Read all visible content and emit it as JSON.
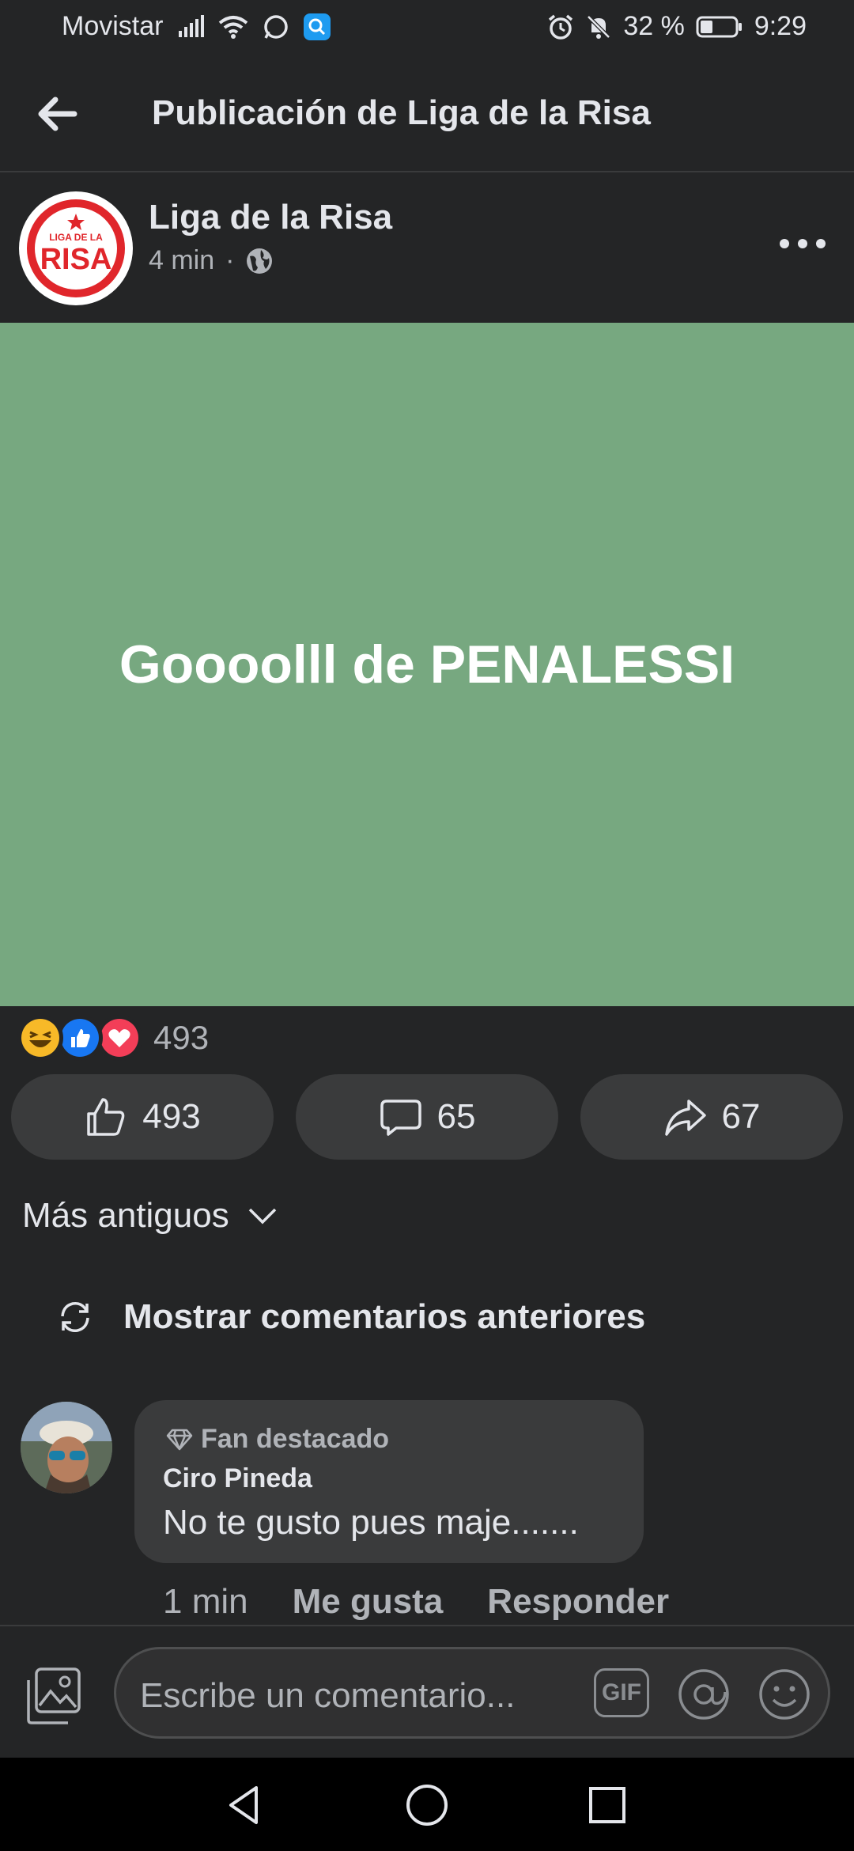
{
  "status_bar": {
    "carrier": "Movistar",
    "battery_percent": "32 %",
    "time": "9:29"
  },
  "app_bar": {
    "title": "Publicación de Liga de la Risa"
  },
  "post": {
    "page_name": "Liga de la Risa",
    "avatar_text_top": "LIGA DE LA",
    "avatar_text_main": "RISA",
    "time_ago": "4 min",
    "separator": "·",
    "image_text": "Goooolll de PENALESSI",
    "image_bg_color": "#77a880",
    "reaction_count": "493",
    "likes": "493",
    "comments": "65",
    "shares": "67"
  },
  "comments_section": {
    "sort_label": "Más antiguos",
    "load_previous": "Mostrar comentarios anteriores",
    "items": [
      {
        "badge": "Fan destacado",
        "author": "Ciro Pineda",
        "text": "No te gusto pues maje.......",
        "time": "1 min",
        "like_label": "Me gusta",
        "reply_label": "Responder"
      }
    ]
  },
  "composer": {
    "placeholder": "Escribe un comentario...",
    "gif_label": "GIF"
  },
  "colors": {
    "background": "#242526",
    "surface": "#3a3b3c",
    "like_blue": "#1877f2",
    "love_red": "#f33e58",
    "haha_yellow": "#f7b928",
    "avatar_red": "#e0262b"
  }
}
